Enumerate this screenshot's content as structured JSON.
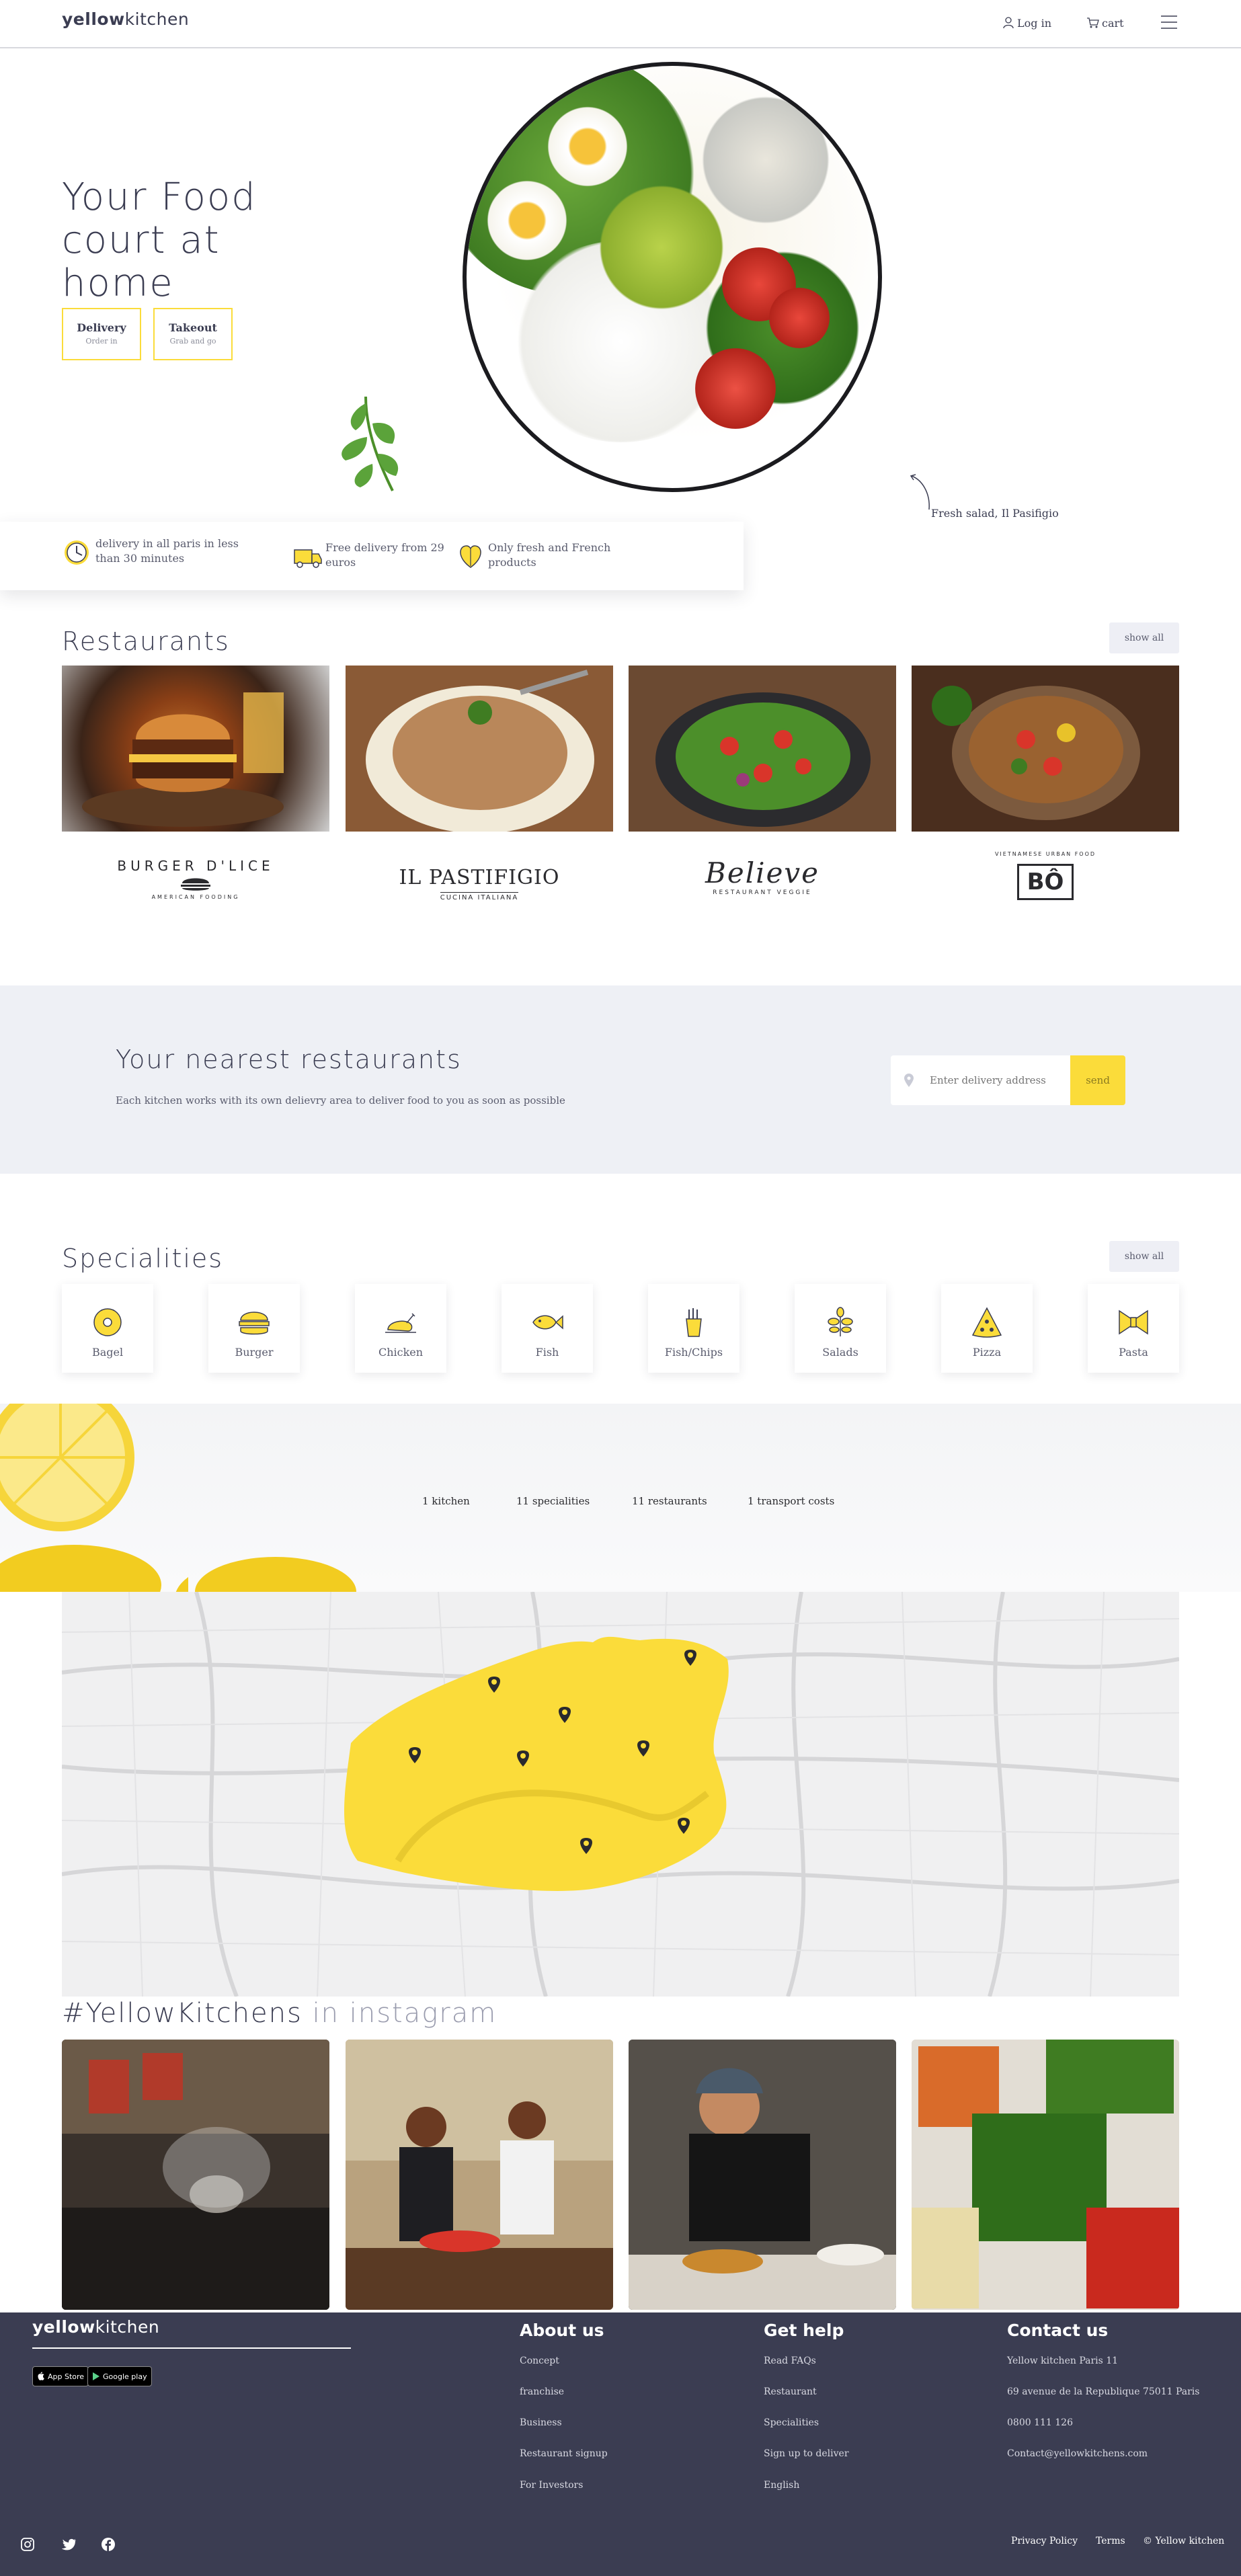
{
  "header": {
    "logo_bold": "yellow",
    "logo_rest": "kitchen",
    "login_label": "Log in",
    "cart_label": "cart"
  },
  "hero": {
    "title": "Your Food court at home",
    "delivery": {
      "title": "Delivery",
      "subtitle": "Order in"
    },
    "takeout": {
      "title": "Takeout",
      "subtitle": "Grab and go"
    },
    "caption": "Fresh salad, Il Pasifigio"
  },
  "features": [
    {
      "icon": "clock-icon",
      "text": "delivery in all paris in less than 30 minutes"
    },
    {
      "icon": "delivery-truck-icon",
      "text": "Free delivery from 29 euros"
    },
    {
      "icon": "heart-leaf-icon",
      "text": "Only fresh and French products"
    }
  ],
  "restaurants": {
    "title": "Restaurants",
    "show_all": "show all",
    "logos": [
      {
        "name": "BURGER D'LICE",
        "tagline": "AMERICAN FOODING"
      },
      {
        "name": "IL PASTIFIGIO",
        "tagline": "CUCINA ITALIANA"
      },
      {
        "name": "Believe",
        "tagline": "RESTAURANT VEGGIE"
      },
      {
        "name": "BÔ",
        "tagline": "VIETNAMESE URBAN FOOD"
      }
    ]
  },
  "nearest": {
    "title": "Your nearest restaurants",
    "subtitle": "Each kitchen works with its own delievry area to deliver food to you as soon as possible",
    "placeholder": "Enter delivery address",
    "send_label": "send"
  },
  "specialities": {
    "title": "Specialities",
    "show_all": "show all",
    "items": [
      {
        "label": "Bagel",
        "icon": "bagel-icon"
      },
      {
        "label": "Burger",
        "icon": "burger-icon"
      },
      {
        "label": "Chicken",
        "icon": "chicken-icon"
      },
      {
        "label": "Fish",
        "icon": "fish-icon"
      },
      {
        "label": "Fish/Chips",
        "icon": "fries-icon"
      },
      {
        "label": "Salads",
        "icon": "salad-icon"
      },
      {
        "label": "Pizza",
        "icon": "pizza-icon"
      },
      {
        "label": "Pasta",
        "icon": "pasta-icon"
      }
    ]
  },
  "stats": [
    "1 kitchen",
    "11 specialities",
    "11 restaurants",
    "1 transport costs"
  ],
  "instagram": {
    "hashtag": "#YellowKitchens",
    "suffix": "in instagram"
  },
  "footer": {
    "logo_bold": "yellow",
    "logo_rest": "kitchen",
    "app_store": "App Store",
    "google_play": "Google play",
    "about": {
      "title": "About us",
      "links": [
        "Concept",
        "franchise",
        "Business",
        "Restaurant signup",
        "For Investors"
      ]
    },
    "help": {
      "title": "Get help",
      "links": [
        "Read FAQs",
        "Restaurant",
        "Specialities",
        "Sign up to deliver",
        "English"
      ]
    },
    "contact": {
      "title": "Contact us",
      "lines": [
        "Yellow kitchen Paris 11",
        "69 avenue de la Republique 75011 Paris",
        "0800 111 126",
        "Contact@yellowkitchens.com"
      ]
    },
    "legal": [
      "Privacy Policy",
      "Terms",
      "© Yellow kitchen"
    ]
  },
  "colors": {
    "accent": "#fbdc3a",
    "dark": "#3b3d52",
    "light_bg": "#eef0f5"
  }
}
